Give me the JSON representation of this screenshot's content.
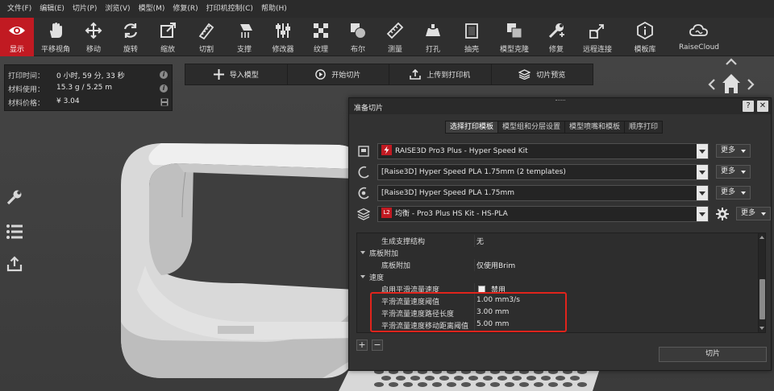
{
  "menubar": {
    "items": [
      "文件(F)",
      "编辑(E)",
      "切片(P)",
      "浏览(V)",
      "模型(M)",
      "修复(R)",
      "打印机控制(C)",
      "帮助(H)"
    ]
  },
  "toolbar": {
    "items": [
      {
        "label": "显示",
        "icon": "eye-icon",
        "active": true
      },
      {
        "label": "平移视角",
        "icon": "hand-icon"
      },
      {
        "label": "移动",
        "icon": "move-icon"
      },
      {
        "label": "旋转",
        "icon": "rotate-icon"
      },
      {
        "label": "缩放",
        "icon": "scale-icon"
      },
      {
        "label": "切割",
        "icon": "cut-icon"
      },
      {
        "label": "支撑",
        "icon": "support-icon"
      },
      {
        "label": "修改器",
        "icon": "modifier-icon"
      },
      {
        "label": "纹理",
        "icon": "texture-icon"
      },
      {
        "label": "布尔",
        "icon": "boolean-icon"
      },
      {
        "label": "测量",
        "icon": "ruler-icon"
      },
      {
        "label": "打孔",
        "icon": "hole-icon"
      },
      {
        "label": "抽壳",
        "icon": "shell-icon"
      },
      {
        "label": "模型克隆",
        "icon": "clone-icon"
      },
      {
        "label": "修复",
        "icon": "repair-icon"
      },
      {
        "label": "远程连接",
        "icon": "remote-icon"
      },
      {
        "label": "模板库",
        "icon": "template-library-icon"
      },
      {
        "label": "RaiseCloud",
        "icon": "cloud-icon"
      }
    ]
  },
  "info": {
    "print_time_label": "打印时间：",
    "print_time_value": "0 小时, 59 分, 33 秒",
    "material_usage_label": "材料使用：",
    "material_usage_value": "15.3 g / 5.25 m",
    "material_price_label": "材料价格：",
    "material_price_value": "¥ 3.04"
  },
  "actions": {
    "import": "导入模型",
    "start_slice": "开始切片",
    "upload": "上传到打印机",
    "preview": "切片预览"
  },
  "dialog": {
    "title": "准备切片",
    "help": "?",
    "close": "✕",
    "tabs": [
      "选择打印模板",
      "模型组和分层设置",
      "模型喷嘴和模板",
      "顺序打印"
    ],
    "active_tab": 0,
    "printer": "RAISE3D Pro3 Plus - Hyper Speed Kit",
    "filament_1": "[Raise3D] Hyper Speed PLA 1.75mm (2 templates)",
    "filament_2": "[Raise3D] Hyper Speed PLA 1.75mm",
    "template_badge": "L2",
    "template": "均衡 - Pro3 Plus HS Kit - HS-PLA",
    "more_label": "更多",
    "tree": {
      "rows": [
        {
          "kind": "item",
          "name": "生成支撑结构",
          "value": "无"
        },
        {
          "kind": "group",
          "name": "底板附加"
        },
        {
          "kind": "item",
          "name": "底板附加",
          "value": "仅使用Brim"
        },
        {
          "kind": "group",
          "name": "速度"
        },
        {
          "kind": "check",
          "name": "启用平滑流量速度",
          "value": "禁用"
        },
        {
          "kind": "item",
          "name": "平滑流量速度阈值",
          "value": "1.00 mm3/s"
        },
        {
          "kind": "item",
          "name": "平滑流量速度路径长度",
          "value": "3.00 mm"
        },
        {
          "kind": "item",
          "name": "平滑流量速度移动距离阈值",
          "value": "5.00 mm"
        }
      ]
    },
    "add_button": "+",
    "remove_button": "−",
    "slice_button": "切片"
  },
  "colors": {
    "accent": "#c11a22",
    "highlight": "#e0241c"
  }
}
